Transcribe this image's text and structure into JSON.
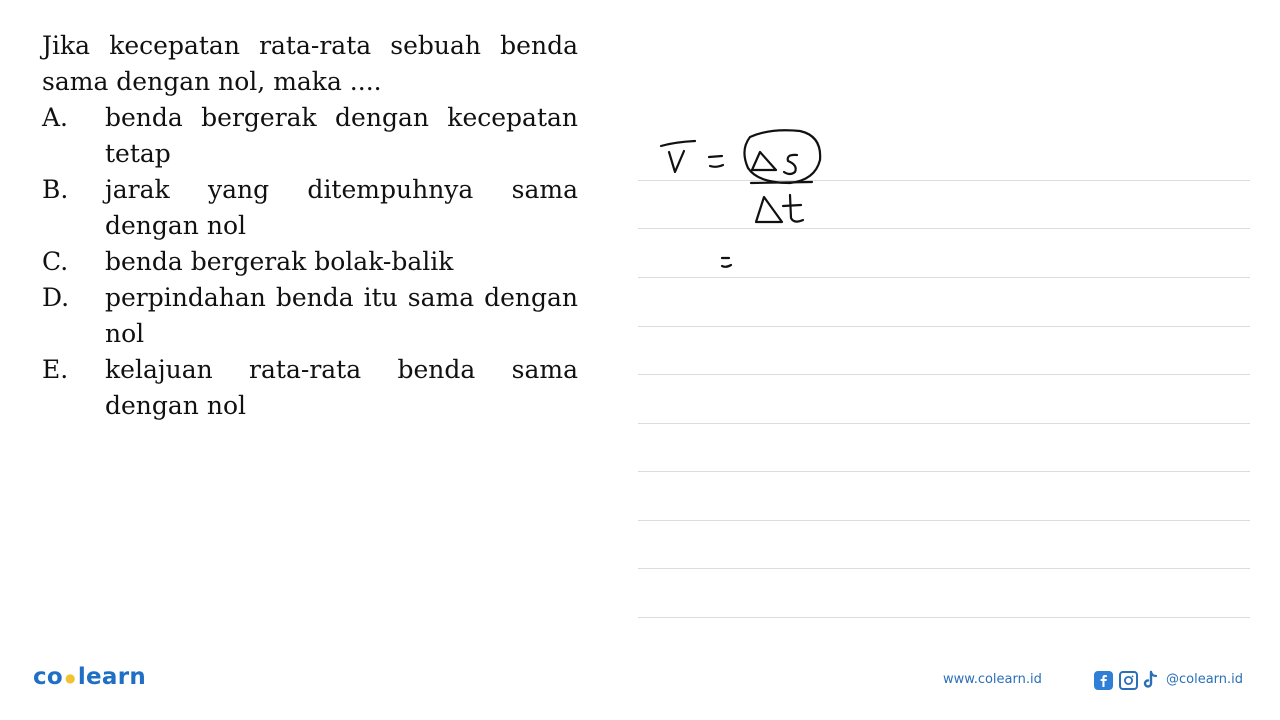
{
  "question": {
    "text": "Jika kecepatan rata-rata sebuah benda sama dengan nol, maka ....",
    "options": [
      {
        "label": "A.",
        "text": "benda bergerak dengan kecepatan tetap"
      },
      {
        "label": "B.",
        "text": "jarak yang ditempuhnya sama dengan nol"
      },
      {
        "label": "C.",
        "text": "benda bergerak bolak-balik"
      },
      {
        "label": "D.",
        "text": "perpindahan benda itu sama dengan nol"
      },
      {
        "label": "E.",
        "text": "kelajuan rata-rata benda sama dengan nol"
      }
    ]
  },
  "handwriting": {
    "formula": "v̄ = Δs / Δt",
    "second_line": "="
  },
  "footer": {
    "logo_left": "co",
    "logo_right": "learn",
    "website": "www.colearn.id",
    "social_handle": "@colearn.id",
    "social_icons": [
      "facebook-icon",
      "instagram-icon",
      "tiktok-icon"
    ],
    "brand_color": "#1f6fc4",
    "accent_color": "#f2c230"
  }
}
